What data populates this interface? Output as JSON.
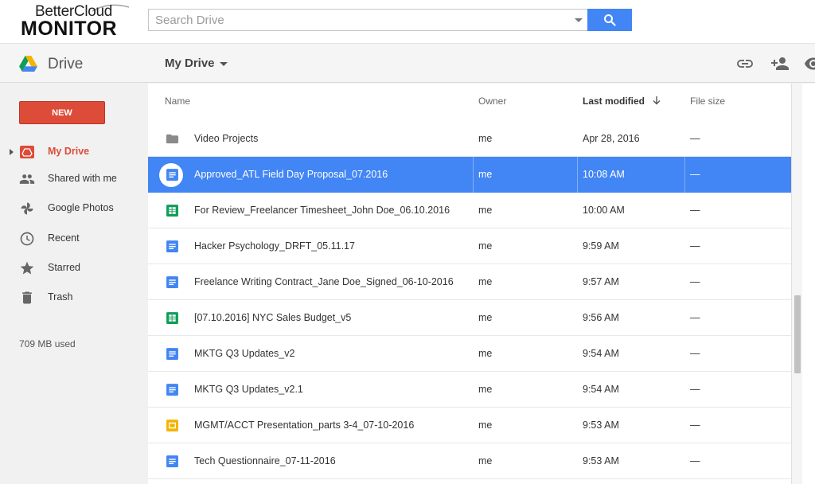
{
  "brand": {
    "line1": "BetterCloud",
    "line2": "MONITOR"
  },
  "search": {
    "placeholder": "Search Drive",
    "button_icon": "search-icon"
  },
  "header": {
    "app_title": "Drive",
    "location": "My Drive",
    "actions": [
      "link-icon",
      "share-person-icon",
      "preview-eye-icon"
    ]
  },
  "sidebar": {
    "new_label": "NEW",
    "items": [
      {
        "label": "My Drive",
        "icon": "my-drive-icon",
        "active": true
      },
      {
        "label": "Shared with me",
        "icon": "people-icon",
        "active": false
      },
      {
        "label": "Google Photos",
        "icon": "photos-pinwheel-icon",
        "active": false
      },
      {
        "label": "Recent",
        "icon": "clock-icon",
        "active": false
      },
      {
        "label": "Starred",
        "icon": "star-icon",
        "active": false
      },
      {
        "label": "Trash",
        "icon": "trash-icon",
        "active": false
      }
    ],
    "storage": "709 MB used"
  },
  "columns": {
    "name": "Name",
    "owner": "Owner",
    "modified": "Last modified",
    "size": "File size"
  },
  "files": [
    {
      "name": "Video Projects",
      "type": "folder",
      "owner": "me",
      "modified": "Apr 28, 2016",
      "size": "—",
      "selected": false
    },
    {
      "name": "Approved_ATL Field Day Proposal_07.2016",
      "type": "doc",
      "owner": "me",
      "modified": "10:08 AM",
      "size": "—",
      "selected": true
    },
    {
      "name": "For Review_Freelancer Timesheet_John Doe_06.10.2016",
      "type": "sheet",
      "owner": "me",
      "modified": "10:00 AM",
      "size": "—",
      "selected": false
    },
    {
      "name": "Hacker Psychology_DRFT_05.11.17",
      "type": "doc",
      "owner": "me",
      "modified": "9:59 AM",
      "size": "—",
      "selected": false
    },
    {
      "name": "Freelance Writing Contract_Jane Doe_Signed_06-10-2016",
      "type": "doc",
      "owner": "me",
      "modified": "9:57 AM",
      "size": "—",
      "selected": false
    },
    {
      "name": "[07.10.2016] NYC Sales Budget_v5",
      "type": "sheet",
      "owner": "me",
      "modified": "9:56 AM",
      "size": "—",
      "selected": false
    },
    {
      "name": "MKTG Q3 Updates_v2",
      "type": "doc",
      "owner": "me",
      "modified": "9:54 AM",
      "size": "—",
      "selected": false
    },
    {
      "name": "MKTG Q3 Updates_v2.1",
      "type": "doc",
      "owner": "me",
      "modified": "9:54 AM",
      "size": "—",
      "selected": false
    },
    {
      "name": "MGMT/ACCT Presentation_parts 3-4_07-10-2016",
      "type": "slides",
      "owner": "me",
      "modified": "9:53 AM",
      "size": "—",
      "selected": false
    },
    {
      "name": "Tech Questionnaire_07-11-2016",
      "type": "doc",
      "owner": "me",
      "modified": "9:53 AM",
      "size": "—",
      "selected": false
    }
  ],
  "colors": {
    "accent_blue": "#4285f4",
    "new_red": "#dd4b39",
    "sheet_green": "#0f9d58",
    "slides_yellow": "#f4b400",
    "folder_gray": "#8a8a8a"
  }
}
